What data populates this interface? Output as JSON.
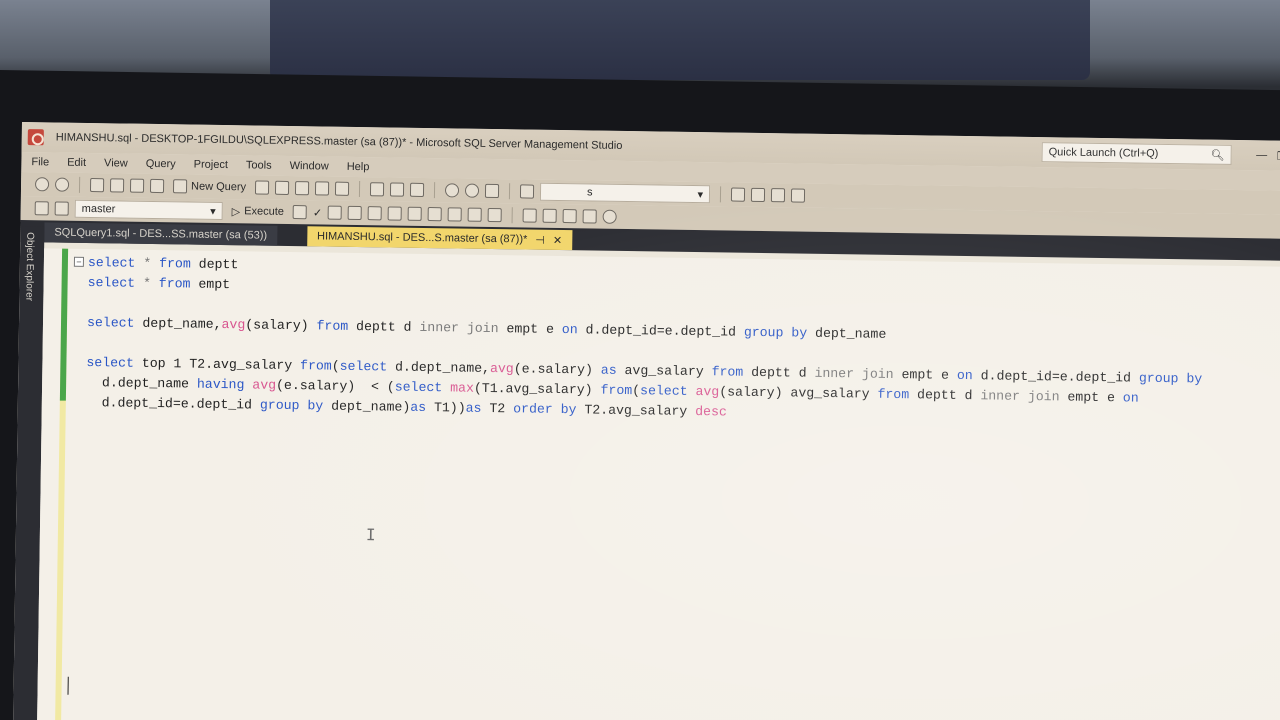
{
  "window": {
    "title": "HIMANSHU.sql - DESKTOP-1FGILDU\\SQLEXPRESS.master (sa (87))* - Microsoft SQL Server Management Studio",
    "quick_launch": "Quick Launch (Ctrl+Q)"
  },
  "menu": [
    "File",
    "Edit",
    "View",
    "Query",
    "Project",
    "Tools",
    "Window",
    "Help"
  ],
  "toolbar": {
    "new_query": "New Query",
    "search_value": "s",
    "database": "master",
    "execute": "Execute"
  },
  "tabs": [
    {
      "label": "SQLQuery1.sql - DES...SS.master (sa (53))",
      "active": false
    },
    {
      "label": "HIMANSHU.sql - DES...S.master (sa (87))*",
      "active": true
    }
  ],
  "sidebar": {
    "label": "Object Explorer"
  },
  "editor": {
    "lines": [
      [
        {
          "t": "select",
          "c": "kw"
        },
        {
          "t": " * ",
          "c": "op"
        },
        {
          "t": "from",
          "c": "kw"
        },
        {
          "t": " deptt",
          "c": ""
        }
      ],
      [
        {
          "t": "select",
          "c": "kw"
        },
        {
          "t": " * ",
          "c": "op"
        },
        {
          "t": "from",
          "c": "kw"
        },
        {
          "t": " empt",
          "c": ""
        }
      ],
      [],
      [
        {
          "t": "select",
          "c": "kw"
        },
        {
          "t": " dept_name,",
          "c": ""
        },
        {
          "t": "avg",
          "c": "fn"
        },
        {
          "t": "(salary) ",
          "c": ""
        },
        {
          "t": "from",
          "c": "kw"
        },
        {
          "t": " deptt d ",
          "c": ""
        },
        {
          "t": "inner join",
          "c": "op"
        },
        {
          "t": " empt e ",
          "c": ""
        },
        {
          "t": "on",
          "c": "kw"
        },
        {
          "t": " d.dept_id=e.dept_id ",
          "c": ""
        },
        {
          "t": "group by",
          "c": "kw"
        },
        {
          "t": " dept_name",
          "c": ""
        }
      ],
      [],
      [
        {
          "t": "select",
          "c": "kw"
        },
        {
          "t": " top 1 T2.avg_salary ",
          "c": ""
        },
        {
          "t": "from",
          "c": "kw"
        },
        {
          "t": "(",
          "c": ""
        },
        {
          "t": "select",
          "c": "kw"
        },
        {
          "t": " d.dept_name,",
          "c": ""
        },
        {
          "t": "avg",
          "c": "fn"
        },
        {
          "t": "(e.salary) ",
          "c": ""
        },
        {
          "t": "as",
          "c": "kw"
        },
        {
          "t": " avg_salary ",
          "c": ""
        },
        {
          "t": "from",
          "c": "kw"
        },
        {
          "t": " deptt d ",
          "c": ""
        },
        {
          "t": "inner join",
          "c": "op"
        },
        {
          "t": " empt e ",
          "c": ""
        },
        {
          "t": "on",
          "c": "kw"
        },
        {
          "t": " d.dept_id=e.dept_id ",
          "c": ""
        },
        {
          "t": "group by",
          "c": "kw"
        }
      ],
      [
        {
          "t": "  d.dept_name ",
          "c": ""
        },
        {
          "t": "having",
          "c": "kw"
        },
        {
          "t": " ",
          "c": ""
        },
        {
          "t": "avg",
          "c": "fn"
        },
        {
          "t": "(e.salary)  < (",
          "c": ""
        },
        {
          "t": "select",
          "c": "kw"
        },
        {
          "t": " ",
          "c": ""
        },
        {
          "t": "max",
          "c": "fn"
        },
        {
          "t": "(T1.avg_salary) ",
          "c": ""
        },
        {
          "t": "from",
          "c": "kw"
        },
        {
          "t": "(",
          "c": ""
        },
        {
          "t": "select",
          "c": "kw"
        },
        {
          "t": " ",
          "c": ""
        },
        {
          "t": "avg",
          "c": "fn"
        },
        {
          "t": "(salary) avg_salary ",
          "c": ""
        },
        {
          "t": "from",
          "c": "kw"
        },
        {
          "t": " deptt d ",
          "c": ""
        },
        {
          "t": "inner join",
          "c": "op"
        },
        {
          "t": " empt e ",
          "c": ""
        },
        {
          "t": "on",
          "c": "kw"
        }
      ],
      [
        {
          "t": "  d.dept_id=e.dept_id ",
          "c": ""
        },
        {
          "t": "group by",
          "c": "kw"
        },
        {
          "t": " dept_name)",
          "c": ""
        },
        {
          "t": "as",
          "c": "kw"
        },
        {
          "t": " T1))",
          "c": ""
        },
        {
          "t": "as",
          "c": "kw"
        },
        {
          "t": " T2 ",
          "c": ""
        },
        {
          "t": "order by",
          "c": "kw"
        },
        {
          "t": " T2.avg_salary ",
          "c": ""
        },
        {
          "t": "desc",
          "c": "fn"
        }
      ]
    ]
  }
}
